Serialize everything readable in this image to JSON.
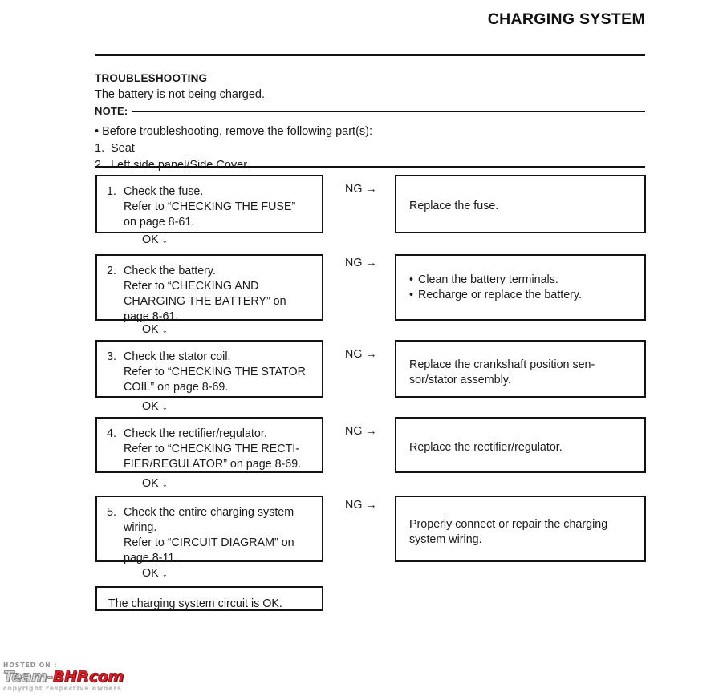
{
  "header": {
    "title": "CHARGING SYSTEM"
  },
  "intro": {
    "heading": "TROUBLESHOOTING",
    "subheading": "The battery is not being charged.",
    "note_label": "NOTE:",
    "note_bullet": "• Before troubleshooting, remove the following part(s):",
    "note_items": [
      {
        "num": "1.",
        "text": "Seat"
      },
      {
        "num": "2.",
        "text": "Left side panel/Side Cover."
      }
    ]
  },
  "flow": {
    "ng_label": "NG →",
    "ok_label": "OK ↓",
    "steps": [
      {
        "num": "1.",
        "lines": [
          "Check the fuse.",
          "Refer to “CHECKING THE FUSE”",
          "on page 8-61."
        ],
        "result_lines": [
          "Replace the fuse."
        ],
        "result_bullets": []
      },
      {
        "num": "2.",
        "lines": [
          "Check the battery.",
          "Refer to “CHECKING AND",
          "CHARGING THE BATTERY” on",
          "page 8-61."
        ],
        "result_lines": [],
        "result_bullets": [
          "Clean the battery terminals.",
          "Recharge or replace the battery."
        ]
      },
      {
        "num": "3.",
        "lines": [
          "Check the stator coil.",
          "Refer to “CHECKING THE STATOR",
          "COIL” on page 8-69."
        ],
        "result_lines": [
          "Replace the crankshaft position sen-",
          "sor/stator assembly."
        ],
        "result_bullets": []
      },
      {
        "num": "4.",
        "lines": [
          "Check the rectifier/regulator.",
          "Refer to “CHECKING THE RECTI-",
          "FIER/REGULATOR” on page 8-69."
        ],
        "result_lines": [
          "Replace the rectifier/regulator."
        ],
        "result_bullets": []
      },
      {
        "num": "5.",
        "lines": [
          "Check the entire charging system",
          "wiring.",
          "Refer to “CIRCUIT DIAGRAM” on",
          "page 8-11."
        ],
        "result_lines": [
          "Properly connect or repair the charging",
          "system wiring."
        ],
        "result_bullets": []
      }
    ],
    "final": "The charging system circuit is OK."
  },
  "watermark": {
    "hosted_on": "HOSTED ON :",
    "brand_team": "Team-",
    "brand_bhp": "BHP.com",
    "copyright": "copyright respective owners"
  },
  "colors": {
    "ink": "#131313",
    "accent_red": "#d6202a"
  }
}
